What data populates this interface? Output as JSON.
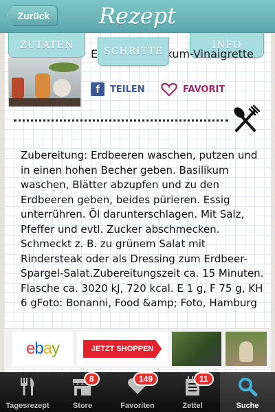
{
  "header": {
    "back_label": "Zurück",
    "title": "Rezept"
  },
  "tabs": [
    {
      "label": "ZUTATEN"
    },
    {
      "label": "SCHRITTE"
    },
    {
      "label": "INFO"
    }
  ],
  "recipe": {
    "title": "Erdbeer-Basilikum-Vinaigrette",
    "share_label": "TEILEN",
    "favorite_label": "FAVORIT"
  },
  "steps_text": "Zubereitung: Erdbeeren waschen, putzen und in einen hohen Becher geben. Basilikum waschen, Blätter abzupfen und zu den Erdbeeren geben, beides pürieren. Essig unterrühren. Öl darunterschlagen. Mit Salz, Pfeffer und evtl. Zucker abschmecken. Schmeckt z. B. zu grünem Salat mit Rindersteak oder als Dressing zum Erdbeer-Spargel-Salat.Zubereitungszeit ca. 15 Minuten. Flasche ca. 3020 kJ, 720 kcal. E 1 g, F 75 g, KH 6 gFoto: Bonanni, Food &amp; Foto, Hamburg",
  "ads": {
    "ebay_letters": [
      "e",
      "b",
      "a",
      "y"
    ],
    "shop_button": "JETZT SHOPPEN"
  },
  "tabbar": {
    "items": [
      {
        "label": "Tagesrezept",
        "icon": "cutlery-icon"
      },
      {
        "label": "Store",
        "icon": "store-icon",
        "badge": "8"
      },
      {
        "label": "Favoriten",
        "icon": "heart-icon",
        "badge": "149"
      },
      {
        "label": "Zettel",
        "icon": "notepad-icon",
        "badge": "11"
      },
      {
        "label": "Suche",
        "icon": "search-icon"
      }
    ]
  },
  "colors": {
    "header": "#6bb8bb",
    "tab": "#a8dde0",
    "facebook": "#3b5998",
    "favorite": "#9b2a6b",
    "badge": "#e0322b"
  }
}
